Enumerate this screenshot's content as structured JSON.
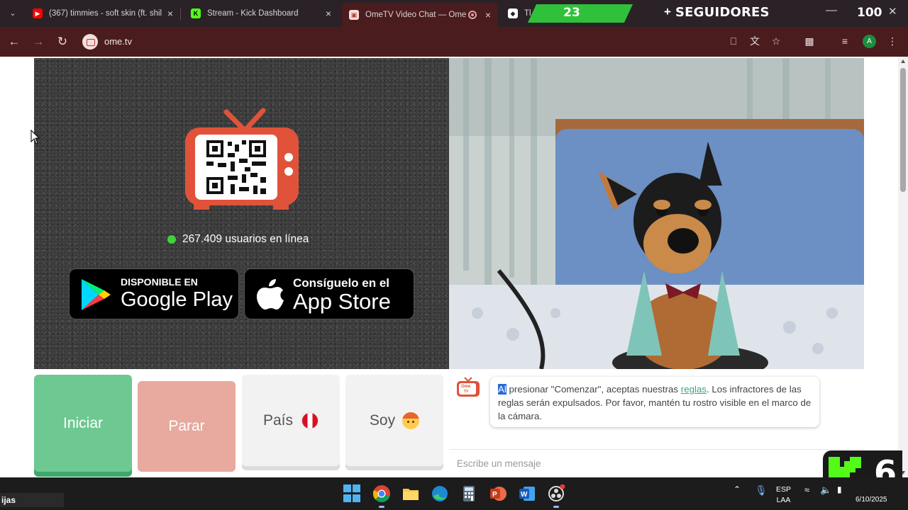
{
  "browser": {
    "tabs": [
      {
        "title": "(367) timmies - soft skin (ft. shil",
        "favicon": "youtube-icon",
        "active": false
      },
      {
        "title": "Stream - Kick Dashboard",
        "favicon": "kick-icon",
        "active": false
      },
      {
        "title": "OmeTV Video Chat — Ome",
        "favicon": "ometv-icon",
        "active": true
      },
      {
        "title": "The b",
        "favicon": "diamond-icon",
        "active": false
      }
    ],
    "url": "ome.tv",
    "profile_initial": "A"
  },
  "stream_overlay": {
    "follower_count": "23",
    "follower_label": "SEGUIDORES",
    "follower_goal": "100",
    "kick_number": "6"
  },
  "page": {
    "online_count_text": "267.409 usuarios en línea",
    "google_play": {
      "small": "DISPONIBLE EN",
      "big": "Google Play"
    },
    "app_store": {
      "small": "Consíguelo en el",
      "big": "App Store"
    },
    "buttons": {
      "start": "Iniciar",
      "stop": "Parar",
      "country": "País",
      "gender": "Soy"
    },
    "chat": {
      "logo_text_1": "Ome",
      "logo_text_2": "TV",
      "msg_highlight": "Al",
      "msg_part1": " presionar \"Comenzar\", aceptas nuestras ",
      "msg_link": "reglas",
      "msg_part2": ". Los infractores de las reglas serán expulsados. Por favor, mantén tu rostro visible en el marco de la cámara.",
      "input_placeholder": "Escribe un mensaje"
    }
  },
  "taskbar": {
    "search_text": "ijas",
    "lang_line1": "ESP",
    "lang_line2": "LAA",
    "date": "6/10/2025"
  },
  "colors": {
    "start": "#6ec891",
    "stop": "#e8a99e",
    "online_dot": "#43d13a",
    "chrome_toolbar": "#4a1c1e",
    "kick_green": "#53fc18"
  }
}
